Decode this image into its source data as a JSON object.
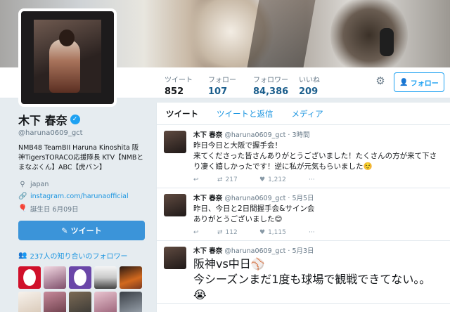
{
  "profile_nav": {
    "stats": [
      {
        "label": "ツイート",
        "value": "852"
      },
      {
        "label": "フォロー",
        "value": "107"
      },
      {
        "label": "フォロワー",
        "value": "84,386"
      },
      {
        "label": "いいね",
        "value": "209"
      }
    ],
    "follow_label": "フォロー"
  },
  "profile": {
    "name": "木下 春奈",
    "handle": "@haruna0609_gct",
    "bio": "NMB48 TeamBII Haruna Kinoshita 阪神TigersTORACO応援隊長 KTV【NMBとまなぶくん】ABC【虎バン】",
    "location": "japan",
    "url": "instagram.com/harunaofficial",
    "birthday": "誕生日 6月09日",
    "tweet_button": "ツイート",
    "followers_you_know": "237人の知り合いのフォロワー",
    "icons": {
      "location": "pin-icon",
      "link": "link-icon",
      "birthday": "balloon-icon",
      "verified": "verified-badge-icon",
      "gear": "gear-icon",
      "people": "people-icon",
      "compose": "compose-icon"
    }
  },
  "timeline": {
    "tabs": [
      "ツイート",
      "ツイートと返信",
      "メディア"
    ],
    "tweets": [
      {
        "name": "木下 春奈",
        "handle": "@haruna0609_gct",
        "time": "3時間",
        "text": "昨日今日と大阪で握手会！\n来てくださった皆さんありがとうございました！たくさんの方が来て下さり凄く嬉しかったです！逆に私が元気もらいました☺️",
        "retweets": "217",
        "likes": "1,212"
      },
      {
        "name": "木下 春奈",
        "handle": "@haruna0609_gct",
        "time": "5月5日",
        "text": "昨日、今日と2日間握手会&サイン会\nありがとうございました😊",
        "retweets": "112",
        "likes": "1,115"
      },
      {
        "name": "木下 春奈",
        "handle": "@haruna0609_gct",
        "time": "5月3日",
        "text": "阪神vs中日⚾\n今シーズンまだ1度も球場で観戦できてない。。😭",
        "retweets": "",
        "likes": ""
      }
    ]
  },
  "colors": {
    "accent": "#1da1f2",
    "link": "#1b95e0",
    "button": "#3b94d9"
  }
}
